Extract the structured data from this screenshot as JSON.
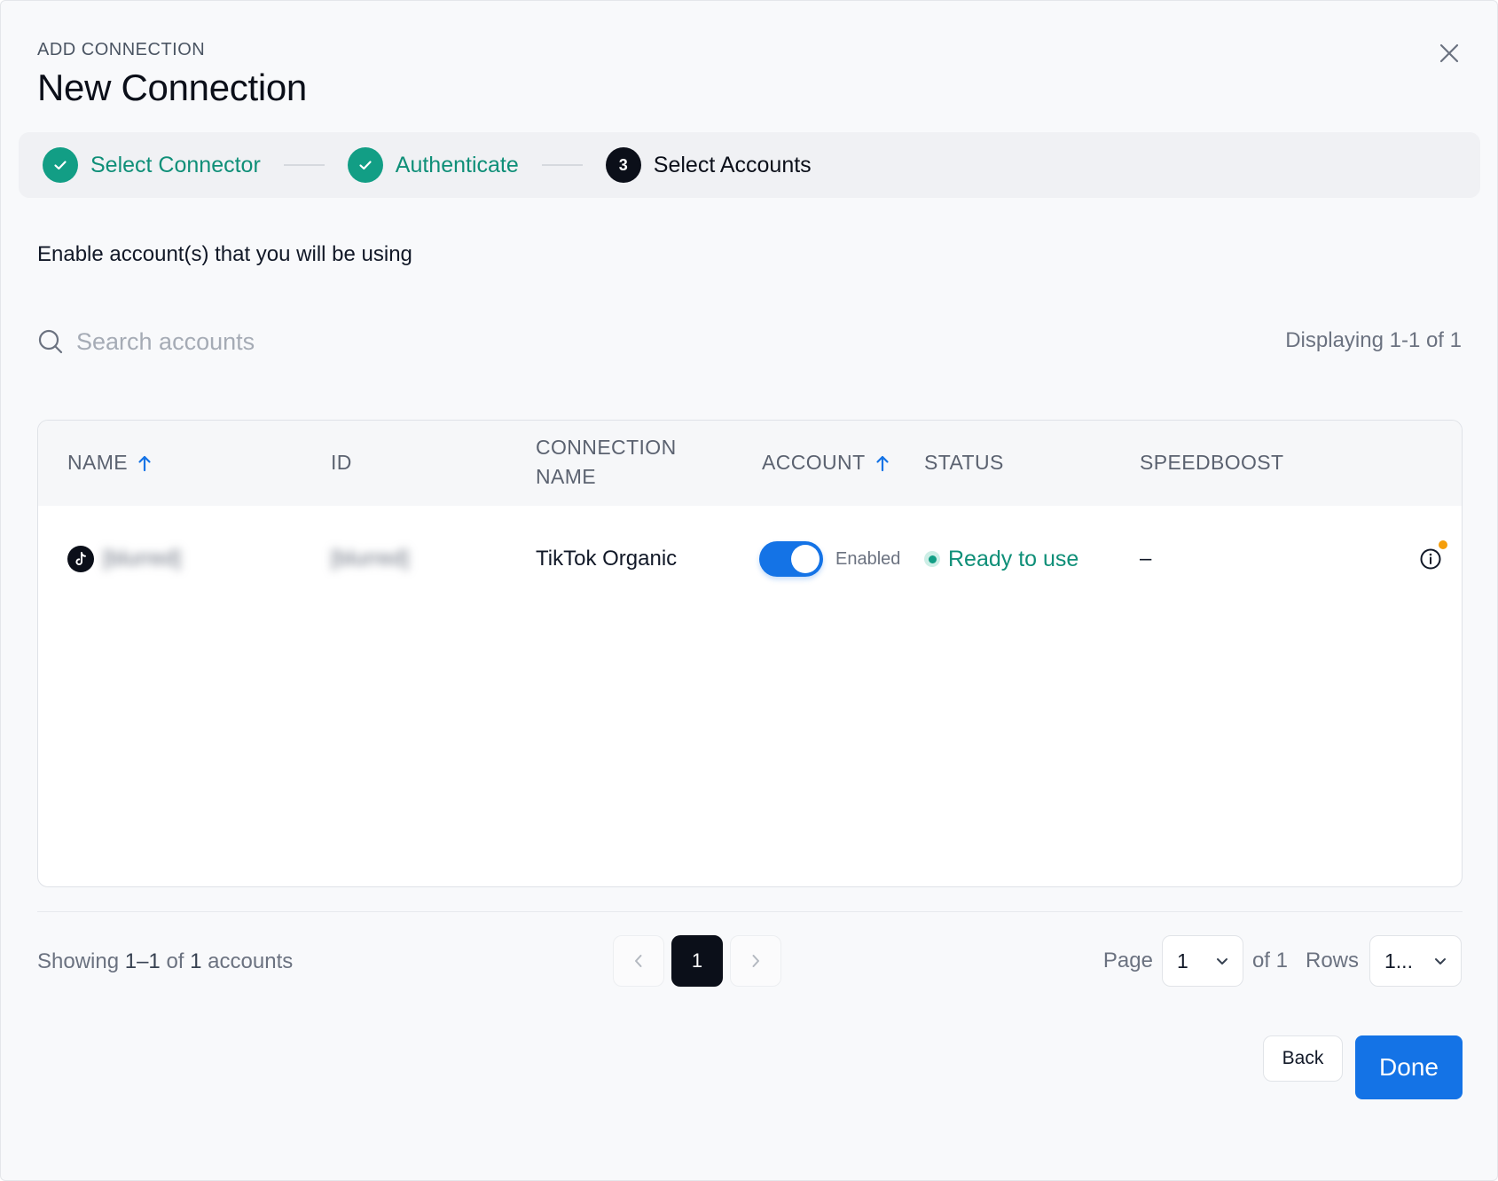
{
  "header": {
    "eyebrow": "ADD CONNECTION",
    "title": "New Connection"
  },
  "steps": [
    {
      "label": "Select Connector",
      "state": "completed"
    },
    {
      "label": "Authenticate",
      "state": "completed"
    },
    {
      "number": "3",
      "label": "Select Accounts",
      "state": "current"
    }
  ],
  "instruction": "Enable account(s) that you will be using",
  "search": {
    "placeholder": "Search accounts",
    "value": ""
  },
  "display_count": "Displaying 1-1 of 1",
  "table": {
    "columns": {
      "name": "NAME",
      "id": "ID",
      "connection_name_line1": "CONNECTION",
      "connection_name_line2": "NAME",
      "account": "ACCOUNT",
      "status": "STATUS",
      "speedboost": "SPEEDBOOST"
    },
    "rows": [
      {
        "icon": "tiktok-icon",
        "name": "[blurred]",
        "id": "[blurred]",
        "connection_name": "TikTok Organic",
        "account_enabled": true,
        "account_label": "Enabled",
        "status": "Ready to use",
        "speedboost": "–"
      }
    ]
  },
  "footer": {
    "showing_prefix": "Showing",
    "showing_range": "1–1",
    "showing_of": "of",
    "showing_total": "1",
    "showing_suffix": "accounts",
    "current_page": "1",
    "page_label": "Page",
    "page_select_value": "1",
    "page_of": "of 1",
    "rows_label": "Rows",
    "rows_select_value": "1..."
  },
  "actions": {
    "back_label": "Back",
    "done_label": "Done"
  },
  "colors": {
    "accent_blue": "#1473e6",
    "success_green": "#129e85",
    "dark": "#0b0f19",
    "badge_orange": "#f59e0b"
  }
}
